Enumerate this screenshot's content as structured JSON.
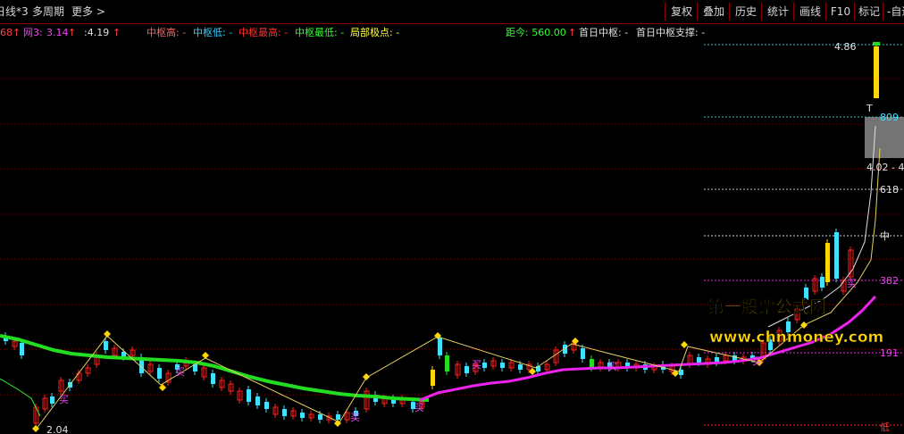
{
  "toolbar": {
    "left_items": [
      "日线*3",
      "多周期",
      "更多 >"
    ],
    "buttons": [
      "复权",
      "叠加",
      "历史",
      "统计",
      "画线",
      "F10",
      "标记",
      "-自适"
    ]
  },
  "infobar": {
    "left_num": "68",
    "wang_label": "网3:",
    "wang_value": "3.14",
    "second_value": ":4.19",
    "zs_high": "中枢高: -",
    "zs_low": "中枢低: -",
    "zs_highest": "中枢最高: -",
    "zs_lowest": "中枢最低: -",
    "local_extreme": "局部极点: -",
    "distance": "距今: 560.00",
    "first_day": "首日中枢: -",
    "first_day_support": "首日中枢支撑: -"
  },
  "price_labels": {
    "top": "4.86",
    "l809": "809",
    "range": "4.02 - 4",
    "l618": "618",
    "mid": "中",
    "l382": "382",
    "l191": "191",
    "low_marker": "低",
    "min_price": "2.04",
    "buy_marker": "买"
  },
  "watermark": {
    "line1": "第一股票公式网",
    "line2": "www.chnmoney.com"
  },
  "colors": {
    "background": "#000000",
    "up": "#ff2020",
    "down": "#40e0ff",
    "ma_green": "#22dd22",
    "ma_magenta": "#ee22ee",
    "yellow": "#ffd700",
    "grid": "#8a0000",
    "watermark_yellow": "#ffd700"
  }
}
